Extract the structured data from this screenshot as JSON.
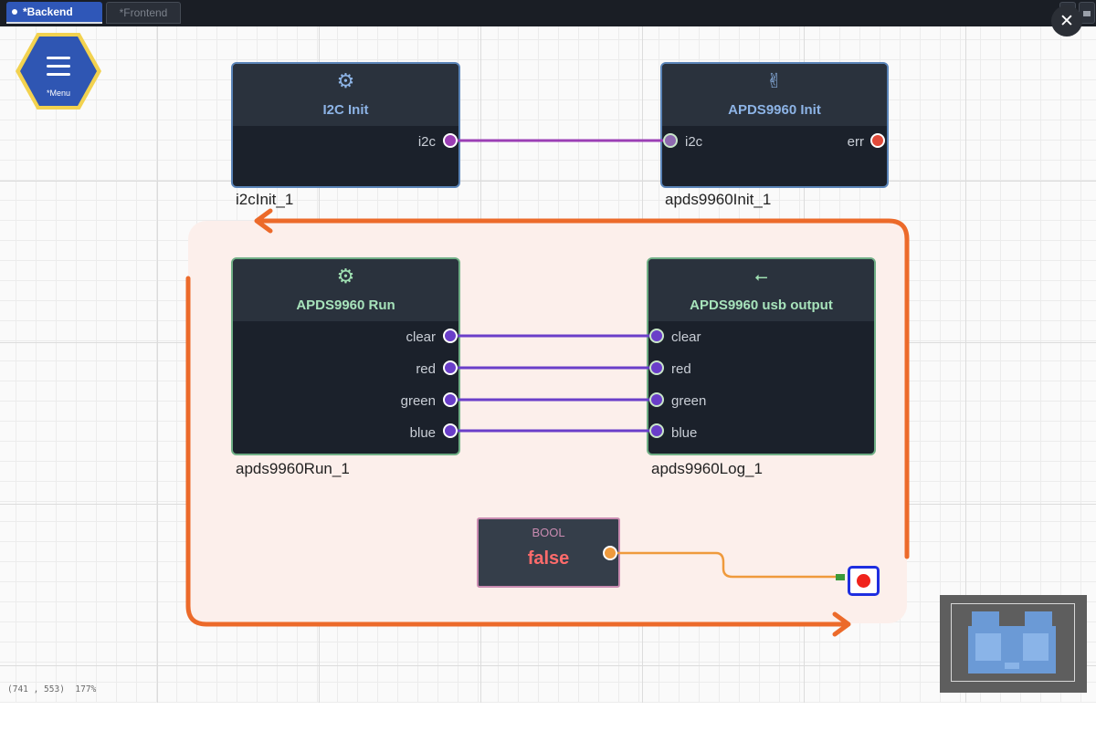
{
  "tabs": [
    {
      "label": "*Backend",
      "active": true
    },
    {
      "label": "*Frontend",
      "active": false
    }
  ],
  "window": {
    "close_symbol": "✕"
  },
  "menu": {
    "label": "*Menu"
  },
  "nodes": {
    "i2c_init": {
      "title": "I2C Init",
      "icon": "gear-icon",
      "outputs": [
        "i2c"
      ],
      "instance": "i2cInit_1"
    },
    "apds_init": {
      "title": "APDS9960 Init",
      "icon": "peace-hand-icon",
      "inputs": [
        "i2c"
      ],
      "outputs": [
        "err"
      ],
      "instance": "apds9960Init_1"
    },
    "apds_run": {
      "title": "APDS9960 Run",
      "icon": "gear-icon",
      "outputs": [
        "clear",
        "red",
        "green",
        "blue"
      ],
      "instance": "apds9960Run_1"
    },
    "apds_log": {
      "title": "APDS9960 usb output",
      "icon": "usb-icon",
      "inputs": [
        "clear",
        "red",
        "green",
        "blue"
      ],
      "instance": "apds9960Log_1"
    },
    "bool": {
      "type": "BOOL",
      "value": "false"
    }
  },
  "status": {
    "coords": "(741 , 553)",
    "zoom": "177%"
  },
  "colors": {
    "i2c_link": "#9b3fb5",
    "data_link": "#6a3ec9",
    "bool_link": "#ef9a3c",
    "loop_arrow": "#ec6a2a",
    "err_port": "#e04a3a"
  }
}
